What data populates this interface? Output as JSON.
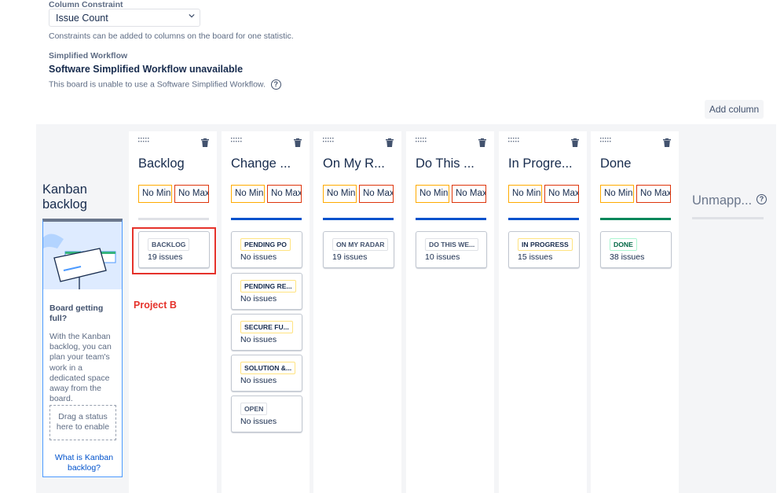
{
  "settings": {
    "column_constraint_label": "Column Constraint",
    "column_constraint_value": "Issue Count",
    "constraint_helper": "Constraints can be added to columns on the board for one statistic.",
    "simplified_workflow_label": "Simplified Workflow",
    "simplified_workflow_title": "Software Simplified Workflow unavailable",
    "simplified_workflow_helper": "This board is unable to use a Software Simplified Workflow.",
    "help_glyph": "?"
  },
  "add_column_label": "Add column",
  "kanban_backlog": {
    "title": "Kanban backlog",
    "body_title": "Board getting full?",
    "body_text": "With the Kanban backlog, you can plan your team's work in a dedicated space away from the board.",
    "drop_text": "Drag a status here to enable",
    "link_text": "What is Kanban backlog?"
  },
  "columns": [
    {
      "title": "Backlog",
      "min": "No Min",
      "max": "No Max",
      "bar_color": "#dfe1e6",
      "statuses": [
        {
          "name": "BACKLOG",
          "issues": "19 issues",
          "style": "grey"
        }
      ]
    },
    {
      "title": "Change ...",
      "min": "No Min",
      "max": "No Max",
      "bar_color": "#0052cc",
      "statuses": [
        {
          "name": "PENDING PO",
          "issues": "No issues",
          "style": "yellow"
        },
        {
          "name": "PENDING RE...",
          "issues": "No issues",
          "style": "yellow"
        },
        {
          "name": "SECURE FU...",
          "issues": "No issues",
          "style": "yellow"
        },
        {
          "name": "SOLUTION &...",
          "issues": "No issues",
          "style": "yellow"
        },
        {
          "name": "OPEN",
          "issues": "No issues",
          "style": "grey"
        }
      ]
    },
    {
      "title": "On My R...",
      "min": "No Min",
      "max": "No Max",
      "bar_color": "#0052cc",
      "statuses": [
        {
          "name": "ON MY RADAR",
          "issues": "19 issues",
          "style": "grey"
        }
      ]
    },
    {
      "title": "Do This ...",
      "min": "No Min",
      "max": "No Max",
      "bar_color": "#0052cc",
      "statuses": [
        {
          "name": "DO THIS WE...",
          "issues": "10 issues",
          "style": "grey"
        }
      ]
    },
    {
      "title": "In Progre...",
      "min": "No Min",
      "max": "No Max",
      "bar_color": "#0052cc",
      "statuses": [
        {
          "name": "IN PROGRESS",
          "issues": "15 issues",
          "style": "yellow"
        }
      ]
    },
    {
      "title": "Done",
      "min": "No Min",
      "max": "No Max",
      "bar_color": "#00875a",
      "statuses": [
        {
          "name": "DONE",
          "issues": "38 issues",
          "style": "green"
        }
      ]
    }
  ],
  "unmapped_title": "Unmapp...",
  "annotation": {
    "label": "Project B",
    "color": "#e5322b"
  }
}
